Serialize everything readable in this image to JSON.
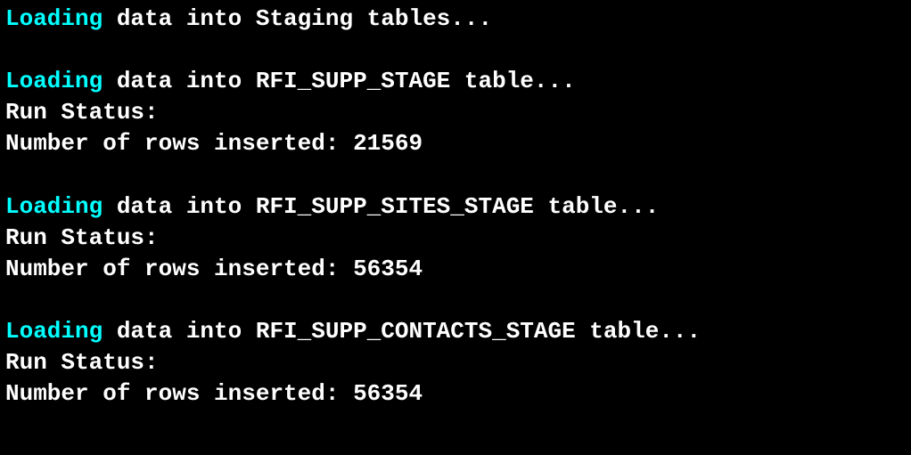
{
  "header": {
    "keyword": "Loading",
    "rest": " data into Staging tables..."
  },
  "blocks": [
    {
      "loading_keyword": "Loading",
      "loading_rest": " data into RFI_SUPP_STAGE table...",
      "status": "Run Status:",
      "rows": "Number of rows inserted: 21569"
    },
    {
      "loading_keyword": "Loading",
      "loading_rest": " data into RFI_SUPP_SITES_STAGE table...",
      "status": "Run Status:",
      "rows": "Number of rows inserted: 56354"
    },
    {
      "loading_keyword": "Loading",
      "loading_rest": " data into RFI_SUPP_CONTACTS_STAGE table...",
      "status": "Run Status:",
      "rows": "Number of rows inserted: 56354"
    }
  ]
}
